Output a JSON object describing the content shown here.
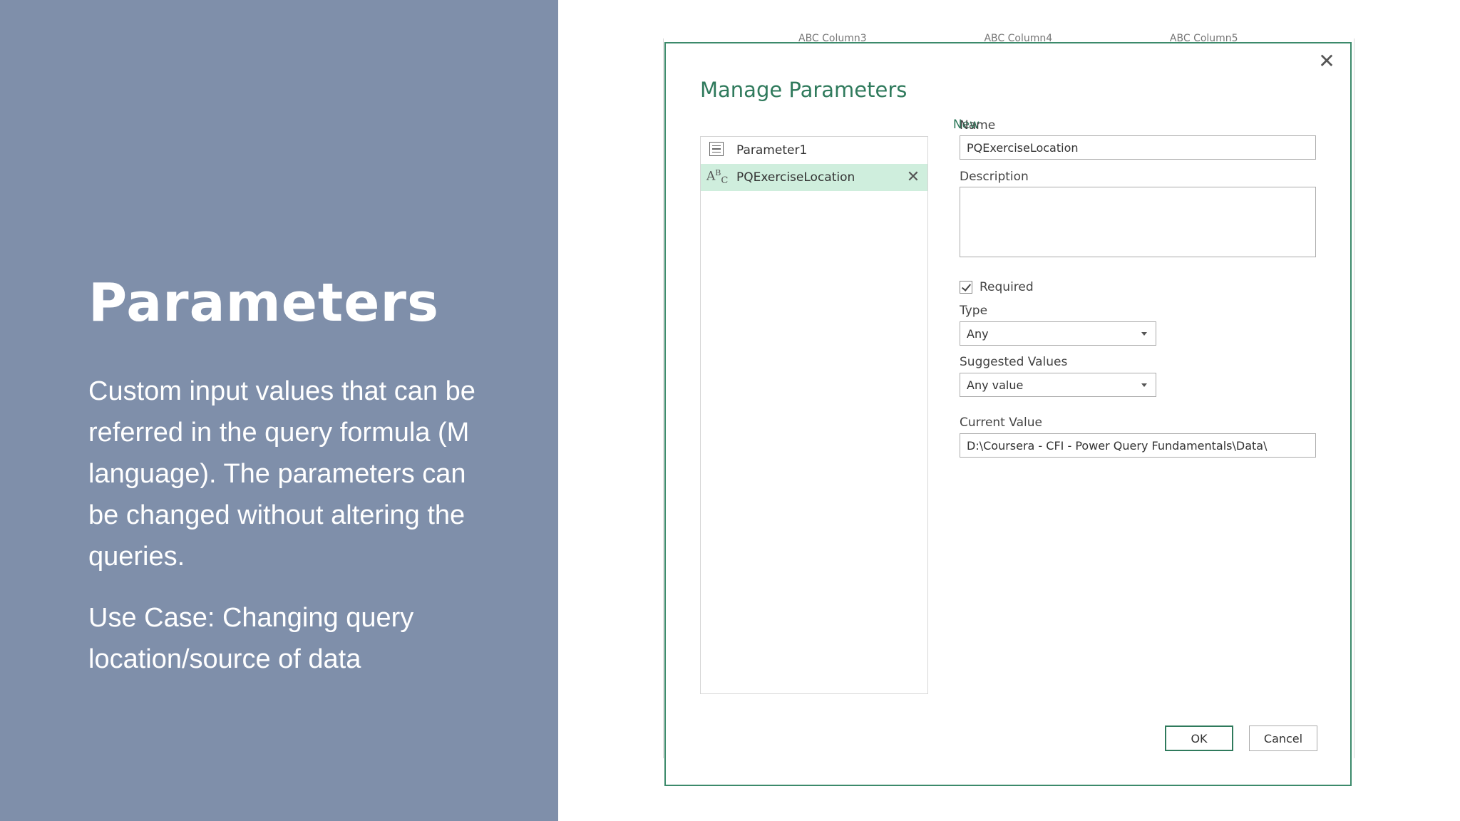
{
  "slide": {
    "title": "Parameters",
    "body": "Custom input values that can be referred in the query formula (M language). The parameters can be changed without altering the queries.",
    "use_case": "Use Case: Changing query location/source of data"
  },
  "background": {
    "column_headers": [
      "ABC Column3",
      "ABC Column4",
      "ABC Column5"
    ]
  },
  "dialog": {
    "title": "Manage Parameters",
    "new_label": "New",
    "close_icon": "close-icon",
    "parameters": [
      {
        "name": "Parameter1",
        "icon": "list-icon",
        "selected": false
      },
      {
        "name": "PQExerciseLocation",
        "icon": "abc-text-icon",
        "selected": true
      }
    ],
    "fields": {
      "name_label": "Name",
      "name_value": "PQExerciseLocation",
      "description_label": "Description",
      "description_value": "",
      "required_label": "Required",
      "required_checked": true,
      "type_label": "Type",
      "type_value": "Any",
      "suggested_label": "Suggested Values",
      "suggested_value": "Any value",
      "current_label": "Current Value",
      "current_value": "D:\\Coursera - CFI - Power Query Fundamentals\\Data\\"
    },
    "buttons": {
      "ok": "OK",
      "cancel": "Cancel"
    },
    "colors": {
      "accent": "#2f7a5c",
      "selected_row": "#cfeedd",
      "panel": "#7f8faa"
    }
  }
}
